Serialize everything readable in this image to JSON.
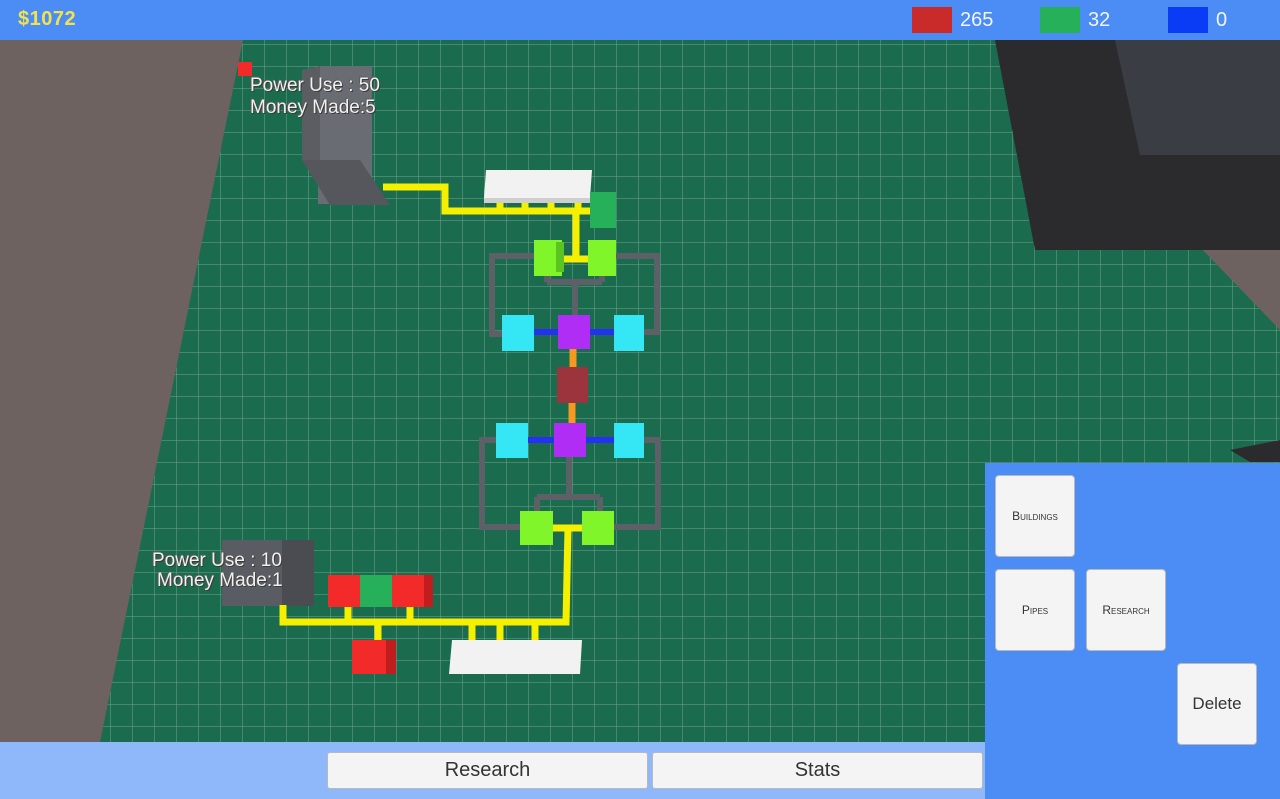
{
  "hud": {
    "money": "$1072",
    "resources": [
      {
        "name": "red-resource",
        "color": "#c92a2a",
        "count": "265"
      },
      {
        "name": "green-resource",
        "color": "#27b05a",
        "count": "32"
      },
      {
        "name": "blue-resource",
        "color": "#0a3cf5",
        "count": "0"
      }
    ]
  },
  "world": {
    "building_top": {
      "power_use": "Power Use : 50",
      "money_made": "Money Made:5"
    },
    "building_bottom": {
      "power_use": "Power Use : 10",
      "money_made": "Money Made:1"
    }
  },
  "panel": {
    "buildings": "Buildings",
    "pipes": "Pipes",
    "research": "Research",
    "delete": "Delete"
  },
  "bottom_bar": {
    "research": "Research",
    "stats": "Stats"
  },
  "colors": {
    "hud_bar": "#4b8df5",
    "grid_floor": "#1b6b4e",
    "money_text": "#f3e34a",
    "power_pipe": "#f5f000",
    "water_pipe": "#2530f5",
    "gray_pipe": "#5d6066",
    "splitter": "#b02df5",
    "cyan_block": "#35e6f5",
    "lime_block": "#7ff52a"
  }
}
